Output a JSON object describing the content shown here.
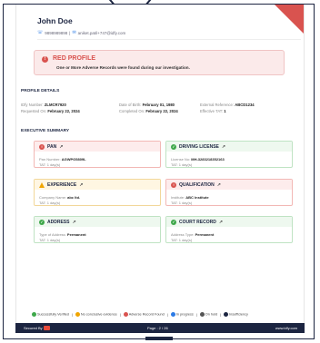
{
  "candidate": {
    "name": "John Doe",
    "phone": "9898989898",
    "email": "aniket.patil+747@idfy.com"
  },
  "alert": {
    "title": "RED PROFILE",
    "message": "One or More Adverse Records were found during our investigation."
  },
  "profile_details": {
    "heading": "PROFILE DETAILS",
    "idfy_number_label": "IDfy Number:",
    "idfy_number": "ZLMCR7920",
    "dob_label": "Date of Birth:",
    "dob": "February 01, 1980",
    "ext_ref_label": "External Reference:",
    "ext_ref": "ABCD1234",
    "requested_label": "Requested On:",
    "requested": "February 22, 2024",
    "completed_label": "Completed On:",
    "completed": "February 22, 2024",
    "effective_tat_label": "Effective TAT:",
    "effective_tat": "1"
  },
  "executive_summary": {
    "heading": "EXECUTIVE SUMMARY",
    "cards": [
      {
        "title": "PAN",
        "field_label": "Pan Number:",
        "field_value": "AGWPG5809L",
        "tat": "TAT: 1 day(s)"
      },
      {
        "title": "DRIVING LICENSE",
        "field_label": "License No:",
        "field_value": "MH-3283218352163",
        "tat": "TAT: 1 day(s)"
      },
      {
        "title": "EXPERIENCE",
        "field_label": "Company Name:",
        "field_value": "abc ltd.",
        "tat": "TAT: 1 day(s)"
      },
      {
        "title": "QUALIFICATION",
        "field_label": "Institute:",
        "field_value": "ABC Institute",
        "tat": "TAT: 1 day(s)"
      },
      {
        "title": "ADDRESS",
        "field_label": "Type of Address:",
        "field_value": "Permanent",
        "tat": "TAT: 1 day(s)"
      },
      {
        "title": "COURT RECORD",
        "field_label": "Address Type:",
        "field_value": "Permanent",
        "tat": "TAT: 1 day(s)"
      }
    ]
  },
  "legend": {
    "verified": "Successfully Verified",
    "no_conclusive": "No conclusive evidence",
    "adverse": "Adverse Record Found",
    "in_progress": "In progress",
    "on_hold": "On hold",
    "insufficiency": "Insufficiency"
  },
  "footer": {
    "secured_by": "Secured By",
    "page": "Page : 2 / 26",
    "website": "www.idfy.com"
  },
  "colors": {
    "red": "#d9534f",
    "green": "#3ea84a",
    "yellow": "#f0a500",
    "navy": "#1c2541",
    "blue": "#2c7be5"
  }
}
